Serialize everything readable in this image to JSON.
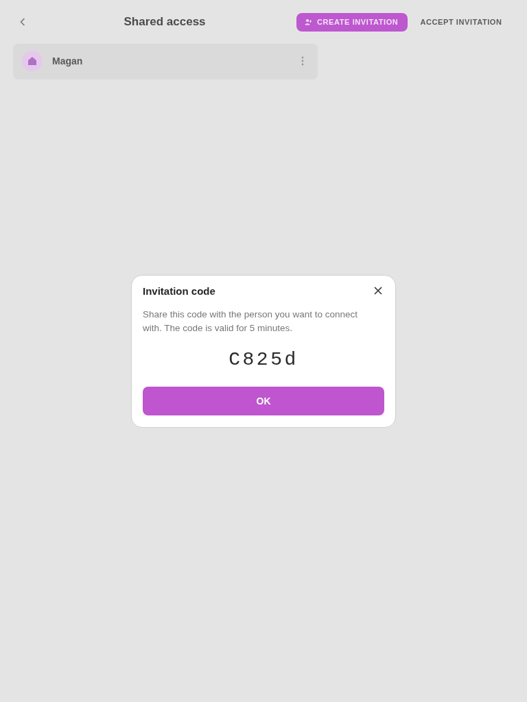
{
  "header": {
    "title": "Shared access"
  },
  "actions": [
    {
      "label": "CREATE INVITATION",
      "kind": "primary"
    },
    {
      "label": "ACCEPT INVITATION",
      "kind": "text"
    }
  ],
  "members": [
    {
      "name": "Magan"
    }
  ],
  "dialog": {
    "title": "Invitation code",
    "message": "Share this code with the person you want to connect with. The code is valid for 5 minutes.",
    "code": "C825d",
    "button": "OK"
  }
}
